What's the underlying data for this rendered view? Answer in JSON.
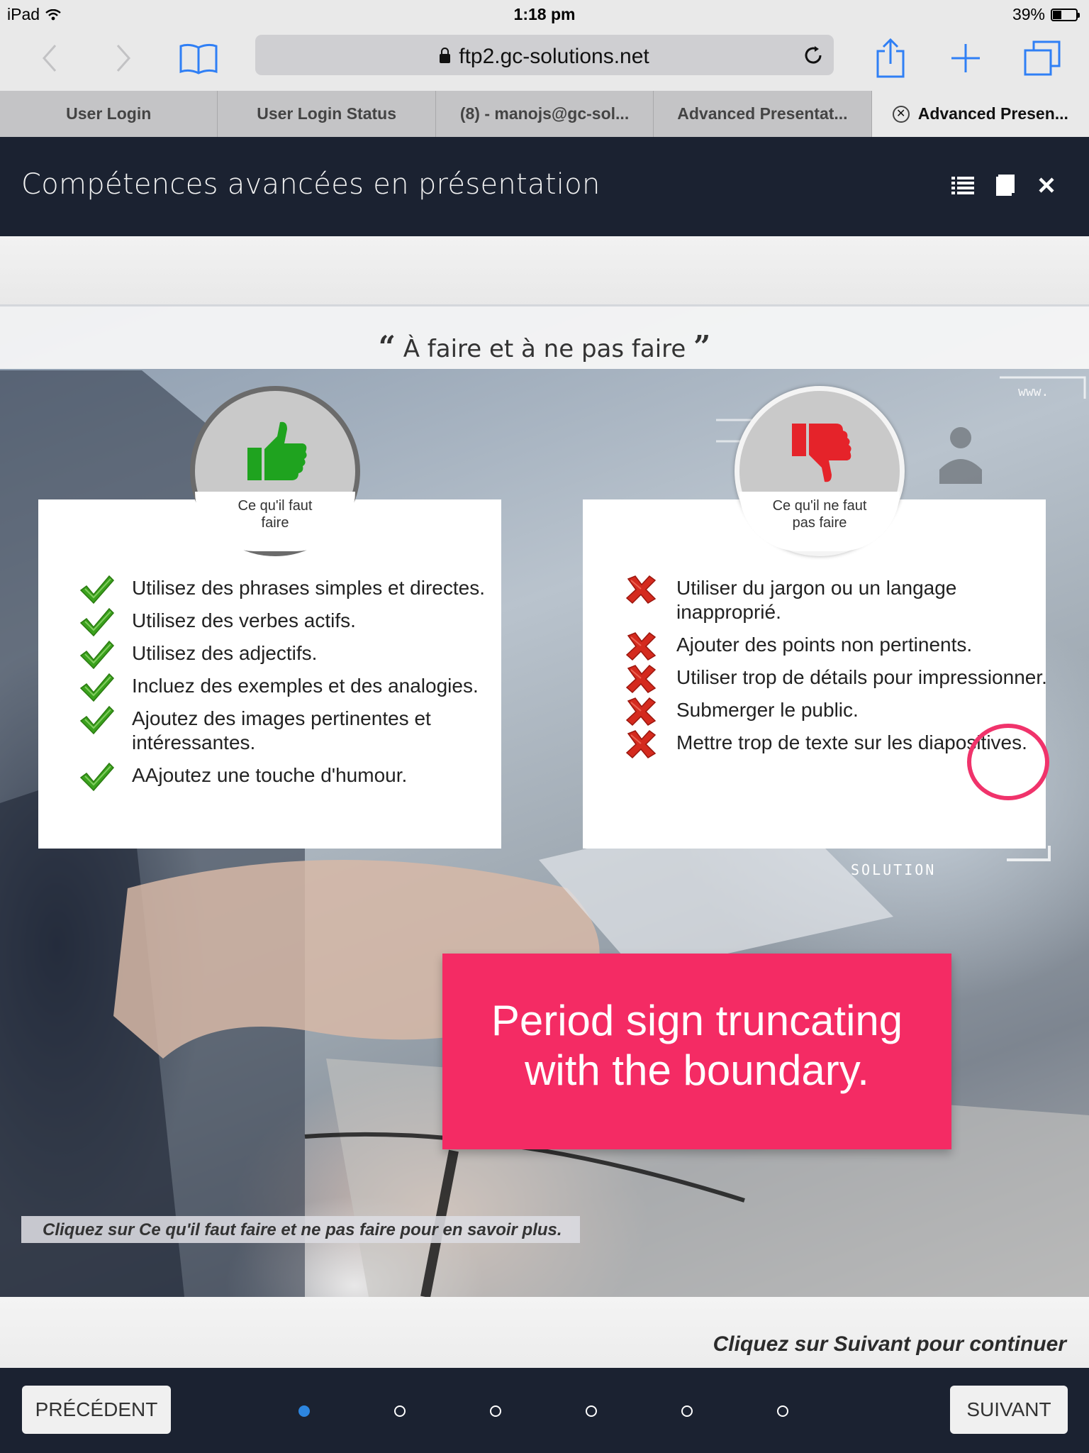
{
  "status_bar": {
    "device": "iPad",
    "time": "1:18 pm",
    "battery": "39%",
    "battery_level": 0.39
  },
  "browser": {
    "url": "ftp2.gc-solutions.net",
    "tabs": [
      {
        "label": "User Login"
      },
      {
        "label": "User Login Status"
      },
      {
        "label": "(8) - manojs@gc-sol..."
      },
      {
        "label": "Advanced Presentat..."
      },
      {
        "label": "Advanced Presen...",
        "active": true
      }
    ]
  },
  "course": {
    "title": "Compétences avancées en présentation"
  },
  "slide": {
    "title": "À faire et à ne pas faire",
    "open_quote": "“",
    "close_quote": "”",
    "do_caption_line1": "Ce qu'il faut",
    "do_caption_line2": "faire",
    "dont_caption_line1": "Ce qu'il ne faut",
    "dont_caption_line2": "pas faire",
    "do_items": [
      "Utilisez des phrases simples et directes.",
      "Utilisez des verbes actifs.",
      "Utilisez des adjectifs.",
      "Incluez des exemples et des analogies.",
      "Ajoutez des images pertinentes et intéressantes.",
      "AAjoutez une touche d'humour."
    ],
    "dont_items": [
      "Utiliser du jargon ou un langage inapproprié.",
      "Ajouter des points non pertinents.",
      "Utiliser trop de détails pour impressionner.",
      "Submerger le public.",
      "Mettre trop de texte sur les diapositives."
    ],
    "background_text_solution": "SOLUTION",
    "background_text_www": "www.",
    "hint": "Cliquez sur Ce qu'il faut faire et ne pas faire pour en savoir plus."
  },
  "annotation": {
    "line1": "Period sign truncating",
    "line2": "with the boundary.",
    "color": "#f42b64"
  },
  "footer": {
    "continue_hint": "Cliquez sur Suivant pour continuer",
    "prev_label": "PRÉCÉDENT",
    "next_label": "SUIVANT",
    "total_pages": 6,
    "current_page": 1
  },
  "colors": {
    "header_bg": "#1b2231",
    "do_green": "#1fa31f",
    "dont_red": "#e5232a",
    "page_dot_active": "#2d86e0"
  }
}
